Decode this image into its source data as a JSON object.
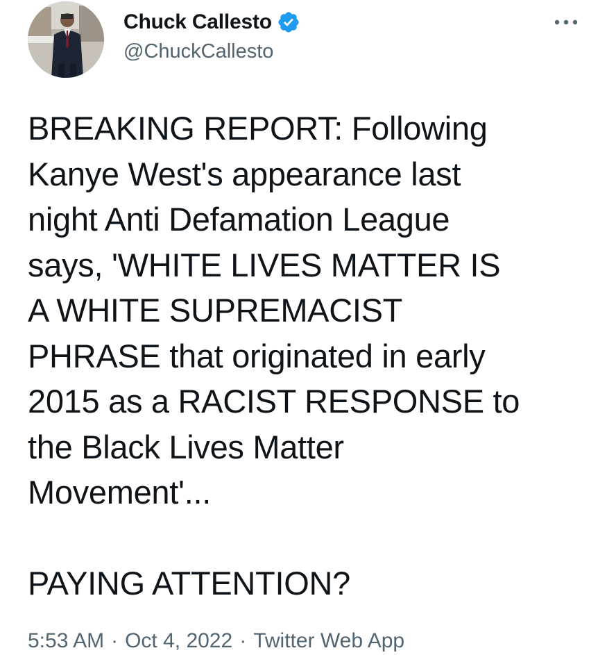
{
  "author": {
    "display_name": "Chuck Callesto",
    "handle": "@ChuckCallesto",
    "verified_icon": "verified-badge-icon",
    "avatar_icon": "avatar-photo"
  },
  "menu": {
    "more_icon": "more-options-icon"
  },
  "tweet": {
    "text": "BREAKING REPORT: Following\nKanye West's appearance last\nnight Anti Defamation League\nsays, 'WHITE LIVES MATTER IS\nA WHITE SUPREMACIST\nPHRASE that originated in early\n2015 as a RACIST RESPONSE to\nthe Black Lives Matter\nMovement'...\n\nPAYING ATTENTION?"
  },
  "meta": {
    "time": "5:53 AM",
    "separator": "·",
    "date": "Oct 4, 2022",
    "source": "Twitter Web App"
  },
  "colors": {
    "text": "#0f1419",
    "secondary": "#536471",
    "verified": "#1d9bf0"
  }
}
